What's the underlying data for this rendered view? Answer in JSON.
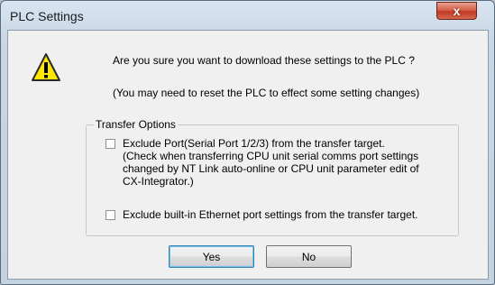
{
  "window": {
    "title": "PLC Settings",
    "close_glyph": "x"
  },
  "message": {
    "icon": "warning-icon",
    "line1": "Are you sure you want to download these settings to the PLC ?",
    "line2": "(You may need to reset the PLC to effect some setting changes)"
  },
  "transfer_options": {
    "label": "Transfer Options",
    "options": [
      {
        "checked": false,
        "lines": [
          "Exclude Port(Serial Port 1/2/3) from the transfer target.",
          "(Check when transferring CPU unit serial comms port settings",
          "changed by NT Link auto-online or CPU unit parameter edit of",
          "CX-Integrator.)"
        ]
      },
      {
        "checked": false,
        "lines": [
          "Exclude built-in Ethernet port settings from the transfer target."
        ]
      }
    ]
  },
  "buttons": {
    "yes": "Yes",
    "no": "No"
  },
  "colors": {
    "warning_fill": "#ffe600",
    "close_button": "#c13a24",
    "default_button_focus": "#3c7fb1"
  }
}
